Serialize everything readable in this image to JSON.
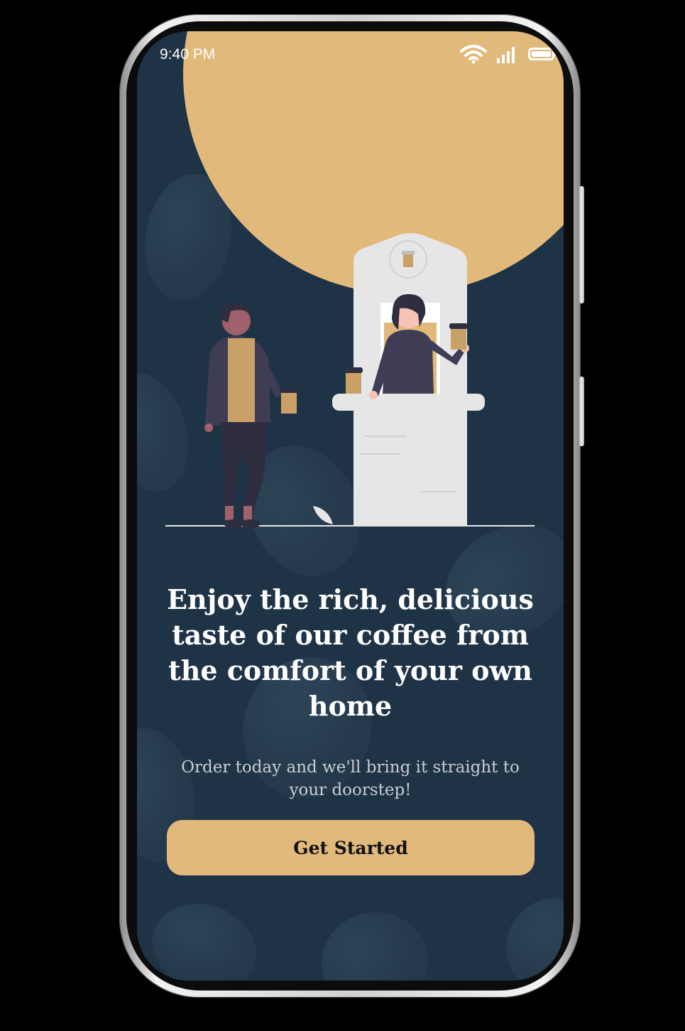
{
  "status_bar": {
    "time": "9:40 PM",
    "wifi_icon": "wifi-icon",
    "signal_icon": "signal-icon",
    "battery_icon": "battery-icon"
  },
  "illustration": {
    "name": "coffee-stand-illustration"
  },
  "onboarding": {
    "headline": "Enjoy the rich, delicious taste of our coffee from the comfort of your own home",
    "subtext": "Order today and we'll bring it straight to your doorstep!",
    "cta_label": "Get Started"
  },
  "colors": {
    "background": "#1f3347",
    "accent": "#e1b97b",
    "text_primary": "#ffffff",
    "text_secondary": "#c9cdd3",
    "button_text": "#111111"
  }
}
